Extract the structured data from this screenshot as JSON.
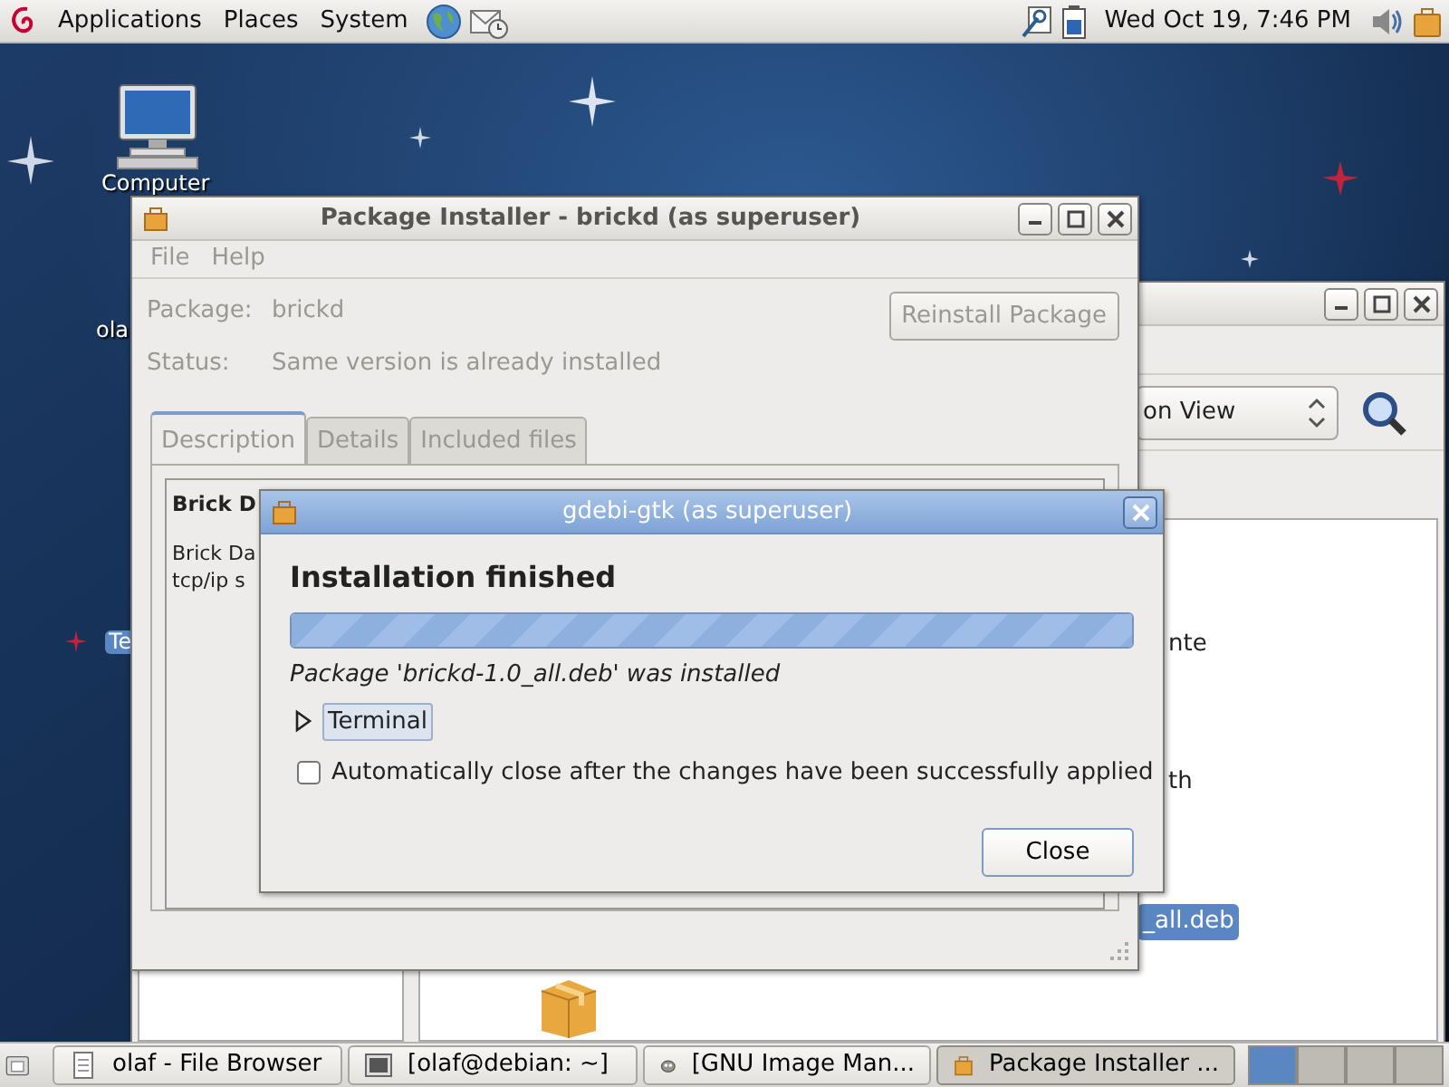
{
  "top_panel": {
    "menus": [
      "Applications",
      "Places",
      "System"
    ],
    "clock": "Wed Oct 19,  7:46 PM"
  },
  "desktop_icons": [
    {
      "label": "Computer",
      "kind": "computer",
      "selected": false
    },
    {
      "label": "ola",
      "kind": "label",
      "selected": false
    },
    {
      "label": "Te",
      "kind": "label",
      "selected": true
    }
  ],
  "file_browser": {
    "view_mode": "on View",
    "items": [
      {
        "label": "nte",
        "selected": false
      },
      {
        "label": "th",
        "selected": false
      },
      {
        "label": "_all.deb",
        "selected": true
      }
    ]
  },
  "package_installer": {
    "title": "Package Installer - brickd (as superuser)",
    "disabled": true,
    "menus": [
      "File",
      "Help"
    ],
    "fields": [
      {
        "label": "Package:",
        "value": "brickd"
      },
      {
        "label": "Status:",
        "value": "Same version is already installed"
      }
    ],
    "reinstall_button": "Reinstall Package",
    "tabs": [
      {
        "label": "Description",
        "selected": true
      },
      {
        "label": "Details",
        "selected": false
      },
      {
        "label": "Included files",
        "selected": false
      }
    ],
    "description_title": "Brick D",
    "description_lines": [
      "Brick Da",
      "tcp/ip s"
    ]
  },
  "dialog": {
    "title": "gdebi-gtk (as superuser)",
    "heading": "Installation finished",
    "progress": {
      "level": 1
    },
    "message": "Package 'brickd-1.0_all.deb' was installed",
    "expander": {
      "label": "Terminal",
      "expanded": false
    },
    "auto_close": {
      "label": "Automatically close after the changes have been successfully applied",
      "checked": false
    },
    "close_button": "Close"
  },
  "taskbar": {
    "tasks": [
      {
        "label": "olaf - File Browser",
        "kind": "files",
        "selected": false
      },
      {
        "label": "[olaf@debian: ~]",
        "kind": "terminal",
        "selected": false
      },
      {
        "label": "[GNU Image Man...",
        "kind": "gimp",
        "selected": false
      },
      {
        "label": "Package Installer ...",
        "kind": "package",
        "selected": true
      }
    ],
    "workspaces": [
      {
        "selected": true
      },
      {
        "selected": false
      },
      {
        "selected": false
      },
      {
        "selected": false
      }
    ]
  }
}
